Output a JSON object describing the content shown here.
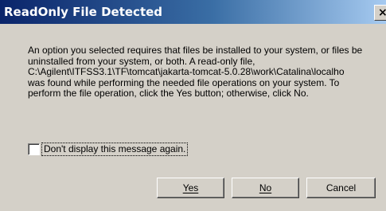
{
  "dialog": {
    "title": "ReadOnly File Detected",
    "close_glyph": "×",
    "message_lines": [
      "An option you selected requires that files be installed to your system, or files be",
      "uninstalled from your system, or both. A read-only file,",
      "C:\\Agilent\\ITFSS3.1\\TF\\tomcat\\jakarta-tomcat-5.0.28\\work\\Catalina\\localho",
      "was found while performing the needed file operations on your system. To",
      "perform the file operation, click the Yes button; otherwise, click No."
    ],
    "checkbox_label": "Don't display this message again.",
    "checkbox_checked": false,
    "buttons": {
      "yes": "Yes",
      "no": "No",
      "cancel": "Cancel"
    }
  },
  "colors": {
    "titlebar_start": "#0a246a",
    "titlebar_end": "#a6caf0",
    "dialog_bg": "#d4d0c8"
  },
  "icons": {
    "close": "close-icon"
  }
}
